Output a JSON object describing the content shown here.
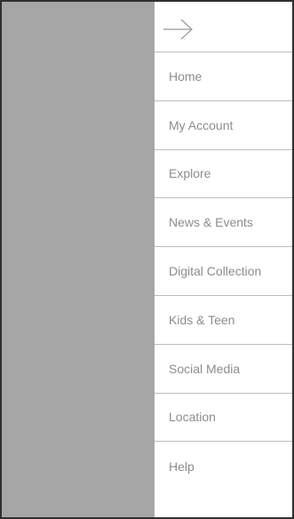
{
  "drawer": {
    "close_icon": "arrow-right-icon",
    "items": [
      {
        "label": "Home"
      },
      {
        "label": "My Account"
      },
      {
        "label": "Explore"
      },
      {
        "label": "News & Events"
      },
      {
        "label": "Digital Collection"
      },
      {
        "label": "Kids & Teen"
      },
      {
        "label": "Social Media"
      },
      {
        "label": "Location"
      },
      {
        "label": "Help"
      }
    ]
  },
  "colors": {
    "overlay": "#a6a6a6",
    "divider": "#bdbdbd",
    "text": "#8c8c8c",
    "frame": "#2f2f2f"
  }
}
